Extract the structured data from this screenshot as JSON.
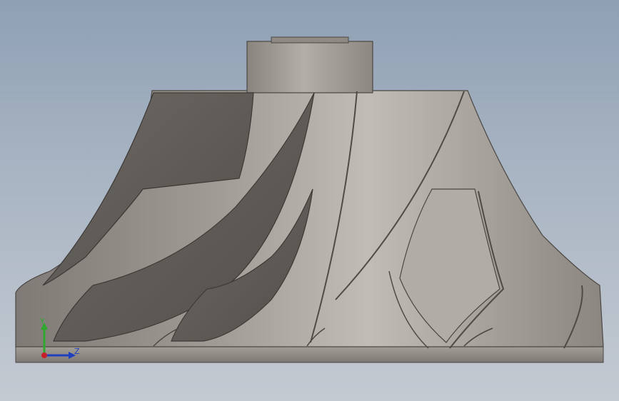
{
  "viewport": {
    "background_top": "#8fa0b4",
    "background_bottom": "#c4cad2"
  },
  "triad": {
    "y_label": "Y",
    "z_label": "Z",
    "y_color": "#2fa82f",
    "z_color": "#1f3fbf",
    "x_color": "#c8202a"
  },
  "model": {
    "description_icon": "impeller-model",
    "material_color": "#9c958f"
  }
}
